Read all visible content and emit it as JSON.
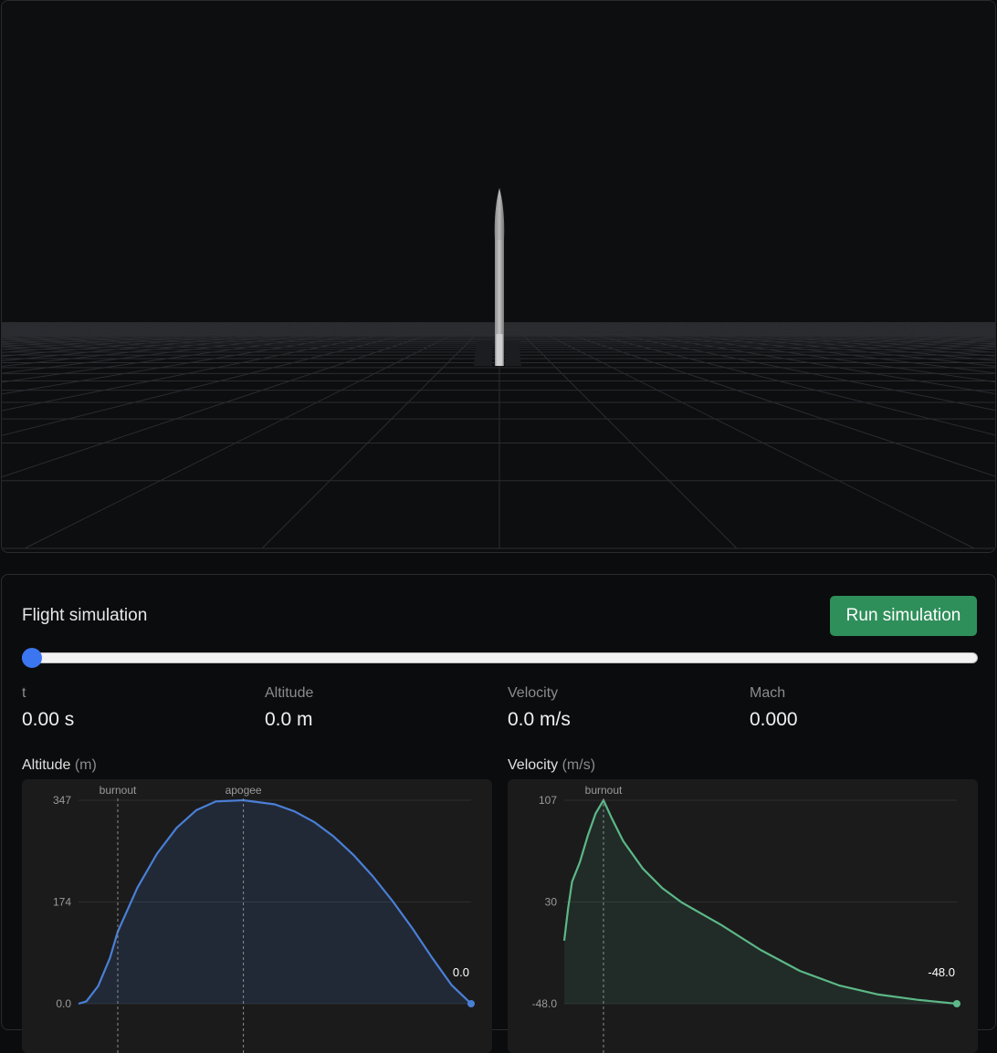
{
  "panel": {
    "title": "Flight simulation",
    "run_label": "Run simulation",
    "slider_value": 0
  },
  "stats": [
    {
      "label": "t",
      "value": "0.00 s"
    },
    {
      "label": "Altitude",
      "value": "0.0 m"
    },
    {
      "label": "Velocity",
      "value": "0.0 m/s"
    },
    {
      "label": "Mach",
      "value": "0.000"
    }
  ],
  "charts": {
    "altitude": {
      "title": "Altitude",
      "unit": "(m)"
    },
    "velocity": {
      "title": "Velocity",
      "unit": "(m/s)"
    }
  },
  "colors": {
    "accent": "#3b76f0",
    "altitude_line": "#4a7fd6",
    "velocity_line": "#5cb887",
    "run_button": "#2f8f5a"
  },
  "chart_data": [
    {
      "type": "area",
      "title": "Altitude",
      "ylabel": "(m)",
      "yticks": [
        "347",
        "174",
        "0.0"
      ],
      "ylim": [
        0,
        347
      ],
      "xlim": [
        0,
        1
      ],
      "markers": [
        {
          "label": "burnout",
          "x": 0.1
        },
        {
          "label": "apogee",
          "x": 0.42
        }
      ],
      "end_label": "0.0",
      "series": [
        {
          "x": [
            0,
            0.02,
            0.05,
            0.08,
            0.1,
            0.15,
            0.2,
            0.25,
            0.3,
            0.35,
            0.42,
            0.5,
            0.55,
            0.6,
            0.65,
            0.7,
            0.75,
            0.8,
            0.85,
            0.9,
            0.95,
            1.0
          ],
          "values": [
            0,
            4,
            30,
            78,
            123,
            198,
            256,
            300,
            330,
            345,
            347,
            340,
            328,
            310,
            285,
            254,
            217,
            175,
            129,
            79,
            32,
            0
          ]
        }
      ]
    },
    {
      "type": "area",
      "title": "Velocity",
      "ylabel": "(m/s)",
      "yticks": [
        "107",
        "30",
        "-48.0"
      ],
      "ylim": [
        -48,
        107
      ],
      "xlim": [
        0,
        1
      ],
      "markers": [
        {
          "label": "burnout",
          "x": 0.1
        }
      ],
      "end_label": "-48.0",
      "series": [
        {
          "x": [
            0,
            0.01,
            0.02,
            0.04,
            0.06,
            0.08,
            0.1,
            0.12,
            0.15,
            0.2,
            0.25,
            0.3,
            0.4,
            0.5,
            0.6,
            0.7,
            0.8,
            0.9,
            1.0
          ],
          "values": [
            0,
            25,
            45,
            60,
            80,
            97,
            107,
            94,
            76,
            55,
            40,
            29,
            12,
            -7,
            -23,
            -34,
            -41,
            -45,
            -48
          ]
        }
      ]
    }
  ]
}
